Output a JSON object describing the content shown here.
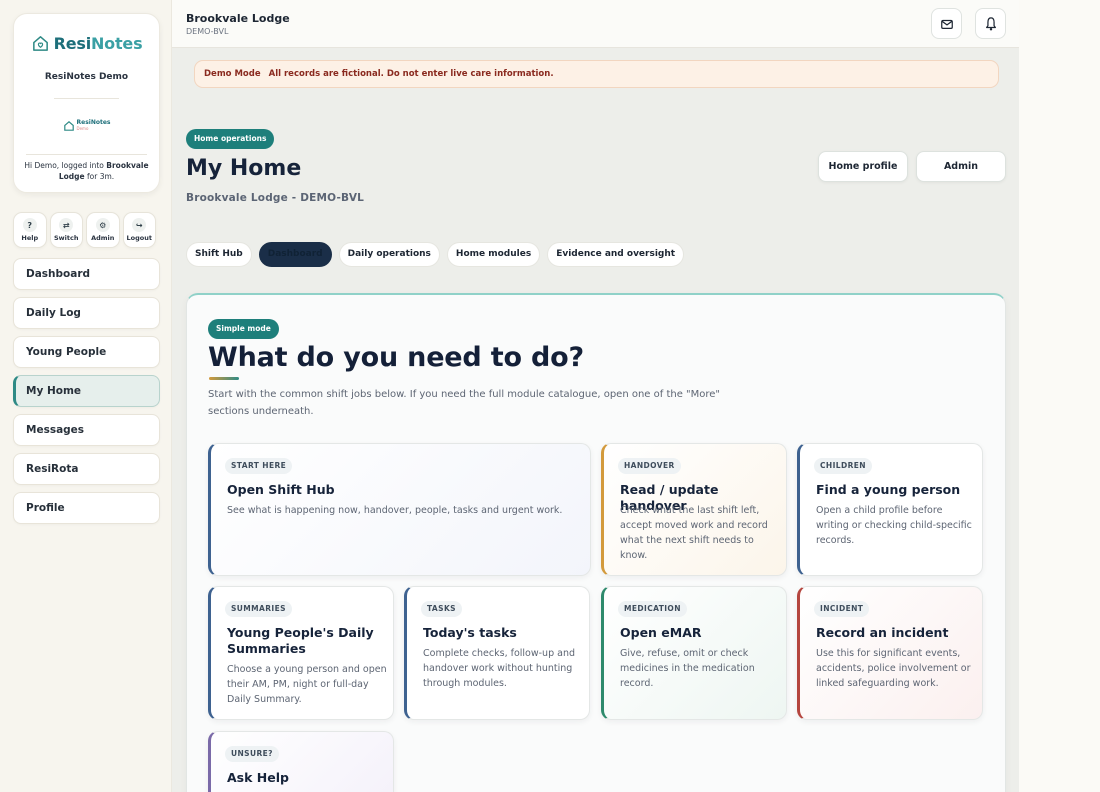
{
  "brand": {
    "name_a": "Resi",
    "name_b": "Notes",
    "org": "ResiNotes Demo",
    "mini_name": "ResiNotes",
    "mini_tag": "Demo",
    "login_prefix": "Hi Demo, logged into ",
    "login_home": "Brookvale Lodge",
    "login_suffix": " for 3m."
  },
  "quick_actions": [
    {
      "icon": "?",
      "label": "Help"
    },
    {
      "icon": "⇄",
      "label": "Switch"
    },
    {
      "icon": "⚙",
      "label": "Admin"
    },
    {
      "icon": "↪",
      "label": "Logout"
    }
  ],
  "nav": [
    {
      "label": "Dashboard"
    },
    {
      "label": "Daily Log"
    },
    {
      "label": "Young People"
    },
    {
      "label": "My Home"
    },
    {
      "label": "Messages"
    },
    {
      "label": "ResiRota"
    },
    {
      "label": "Profile"
    }
  ],
  "topbar": {
    "title": "Brookvale Lodge",
    "code": "DEMO-BVL"
  },
  "banner": {
    "key": "Demo Mode",
    "text": "All records are fictional. Do not enter live care information."
  },
  "page": {
    "pill": "Home operations",
    "title": "My Home",
    "subtitle": "Brookvale Lodge - DEMO-BVL",
    "btn_profile": "Home profile",
    "btn_admin": "Admin"
  },
  "tabs": [
    "Shift Hub",
    "Dashboard",
    "Daily operations",
    "Home modules",
    "Evidence and oversight"
  ],
  "panel": {
    "pill": "Simple mode",
    "heading": "What do you need to do?",
    "intro": "Start with the common shift jobs below. If you need the full module catalogue, open one of the \"More\" sections underneath."
  },
  "cards": [
    {
      "tag": "START HERE",
      "title": "Open Shift Hub",
      "desc": "See what is happening now, handover, people, tasks and urgent work.",
      "accent": "#3e6290"
    },
    {
      "tag": "HANDOVER",
      "title": "Read / update handover",
      "desc": "Check what the last shift left, accept moved work and record what the next shift needs to know.",
      "accent": "#d39a3c"
    },
    {
      "tag": "CHILDREN",
      "title": "Find a young person",
      "desc": "Open a child profile before writing or checking child-specific records.",
      "accent": "#3e6290"
    },
    {
      "tag": "SUMMARIES",
      "title": "Young People's Daily Summaries",
      "desc": "Choose a young person and open their AM, PM, night or full-day Daily Summary.",
      "accent": "#3e6290"
    },
    {
      "tag": "TASKS",
      "title": "Today's tasks",
      "desc": "Complete checks, follow-up and handover work without hunting through modules.",
      "accent": "#3e6290"
    },
    {
      "tag": "MEDICATION",
      "title": "Open eMAR",
      "desc": "Give, refuse, omit or check medicines in the medication record.",
      "accent": "#2e8a6c"
    },
    {
      "tag": "INCIDENT",
      "title": "Record an incident",
      "desc": "Use this for significant events, accidents, police involvement or linked safeguarding work.",
      "accent": "#b5463f"
    },
    {
      "tag": "UNSURE?",
      "title": "Ask Help",
      "desc": "",
      "accent": "#7a6aa8"
    }
  ]
}
